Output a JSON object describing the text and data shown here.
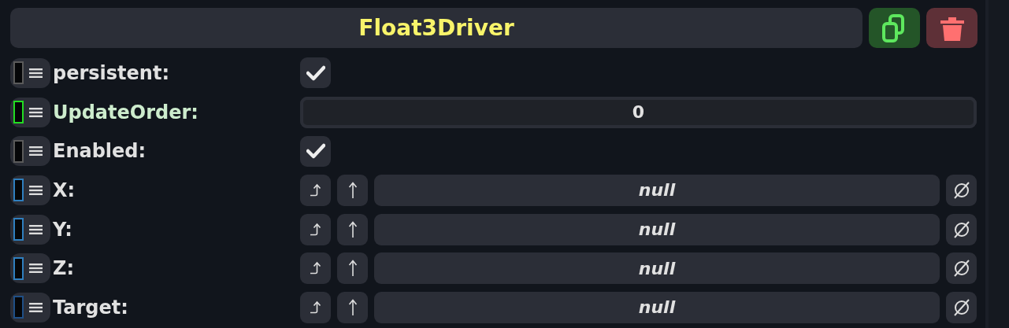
{
  "header": {
    "title": "Float3Driver"
  },
  "fields": [
    {
      "kind": "checkbox",
      "label": "persistent:",
      "highlighted": false,
      "color": "#5a5a5a",
      "checked": true
    },
    {
      "kind": "number",
      "label": "UpdateOrder:",
      "highlighted": true,
      "color": "#22dd22",
      "value": "0"
    },
    {
      "kind": "checkbox",
      "label": "Enabled:",
      "highlighted": false,
      "color": "#5a5a5a",
      "checked": true
    },
    {
      "kind": "reference",
      "label": "X:",
      "highlighted": false,
      "color": "#2f7fbf",
      "value": "null"
    },
    {
      "kind": "reference",
      "label": "Y:",
      "highlighted": false,
      "color": "#2f7fbf",
      "value": "null"
    },
    {
      "kind": "reference",
      "label": "Z:",
      "highlighted": false,
      "color": "#2f7fbf",
      "value": "null"
    },
    {
      "kind": "reference",
      "label": "Target:",
      "highlighted": false,
      "color": "#1f4f86",
      "value": "null"
    }
  ]
}
